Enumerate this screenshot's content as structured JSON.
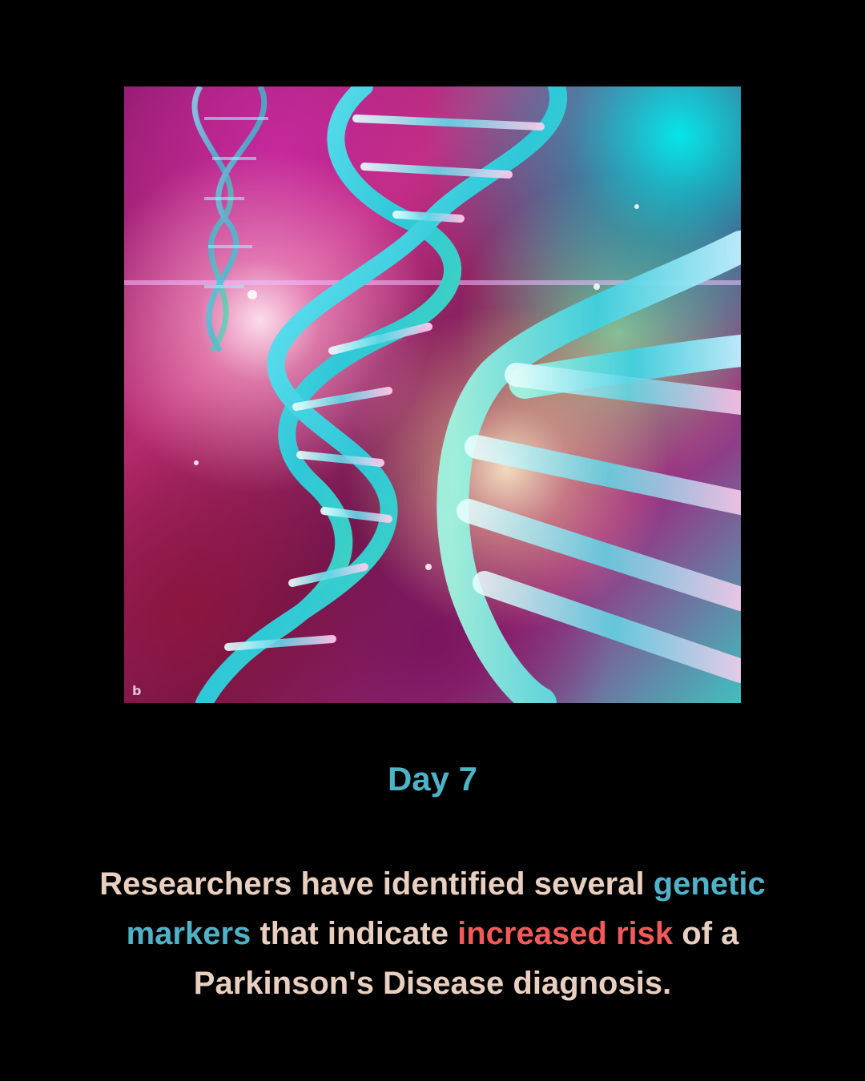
{
  "image": {
    "subject": "DNA double helix strands",
    "watermark_icon": "bing-logo-icon"
  },
  "title": "Day 7",
  "body": {
    "part1": "Researchers have identified several ",
    "highlight1": "genetic markers",
    "part2": " that indicate ",
    "highlight2": "increased risk",
    "part3": " of a Parkinson's Disease diagnosis."
  },
  "colors": {
    "background": "#000000",
    "title": "#4fb3c8",
    "body_text": "#e8cfc0",
    "highlight_blue": "#4fb3c8",
    "highlight_red": "#f25a5a"
  }
}
